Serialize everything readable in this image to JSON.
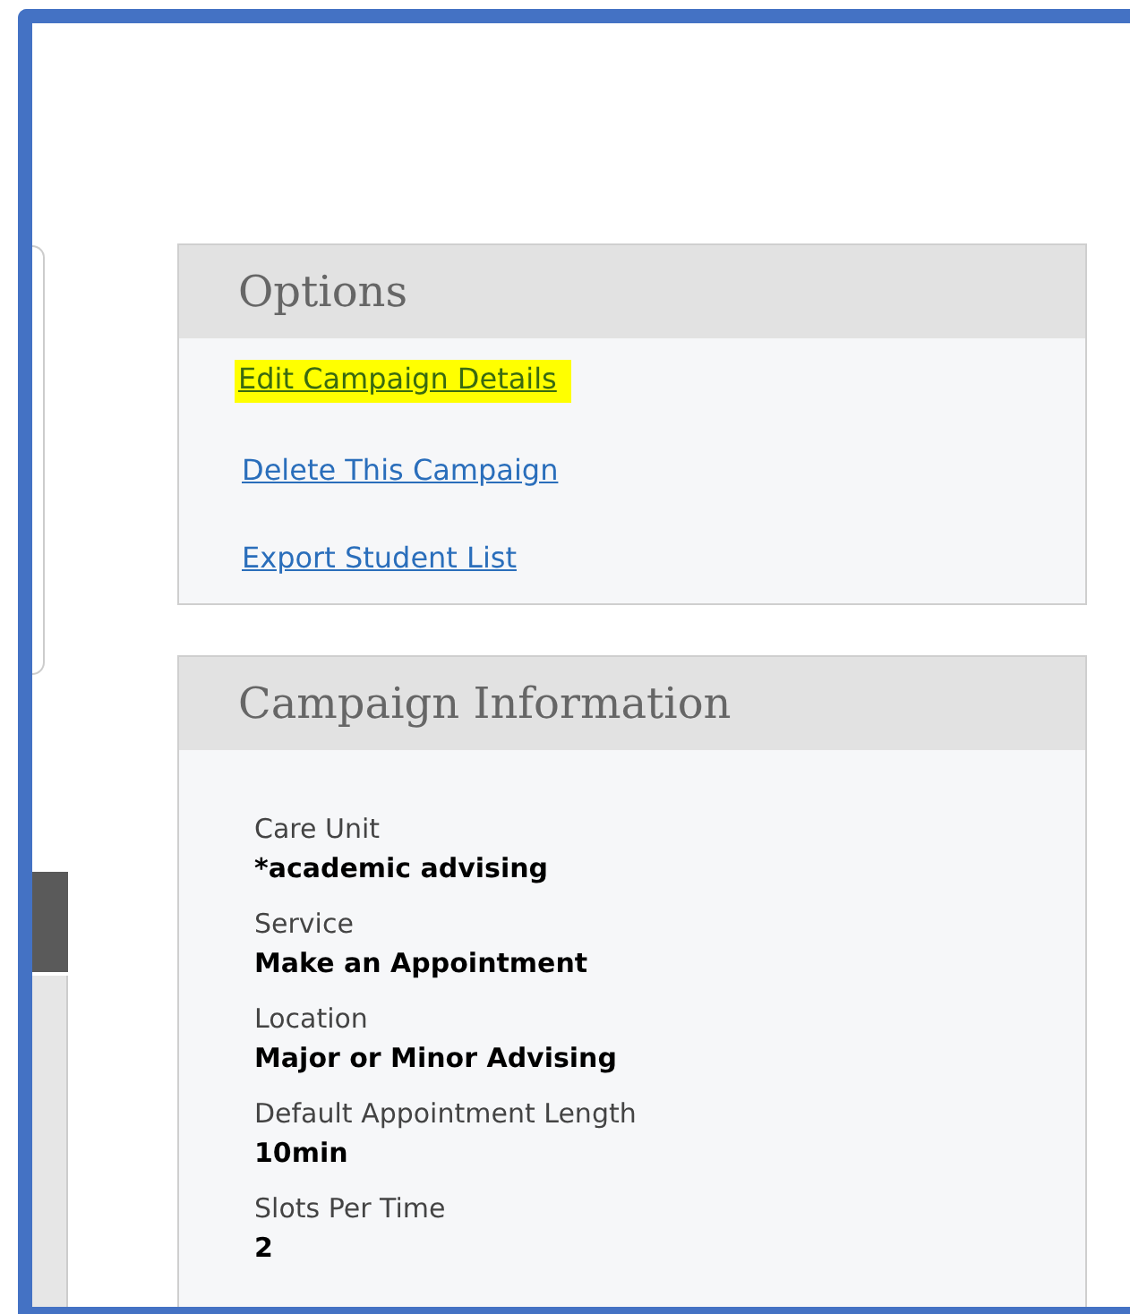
{
  "options": {
    "title": "Options",
    "links": [
      {
        "label": "Edit Campaign Details",
        "highlighted": true
      },
      {
        "label": "Delete This Campaign",
        "highlighted": false
      },
      {
        "label": "Export Student List",
        "highlighted": false
      }
    ]
  },
  "campaign_information": {
    "title": "Campaign Information",
    "fields": [
      {
        "label": "Care Unit",
        "value": "*academic advising"
      },
      {
        "label": "Service",
        "value": "Make an Appointment"
      },
      {
        "label": "Location",
        "value": "Major or Minor Advising"
      },
      {
        "label": "Default Appointment Length",
        "value": "10min"
      },
      {
        "label": "Slots Per Time",
        "value": "2"
      }
    ]
  }
}
